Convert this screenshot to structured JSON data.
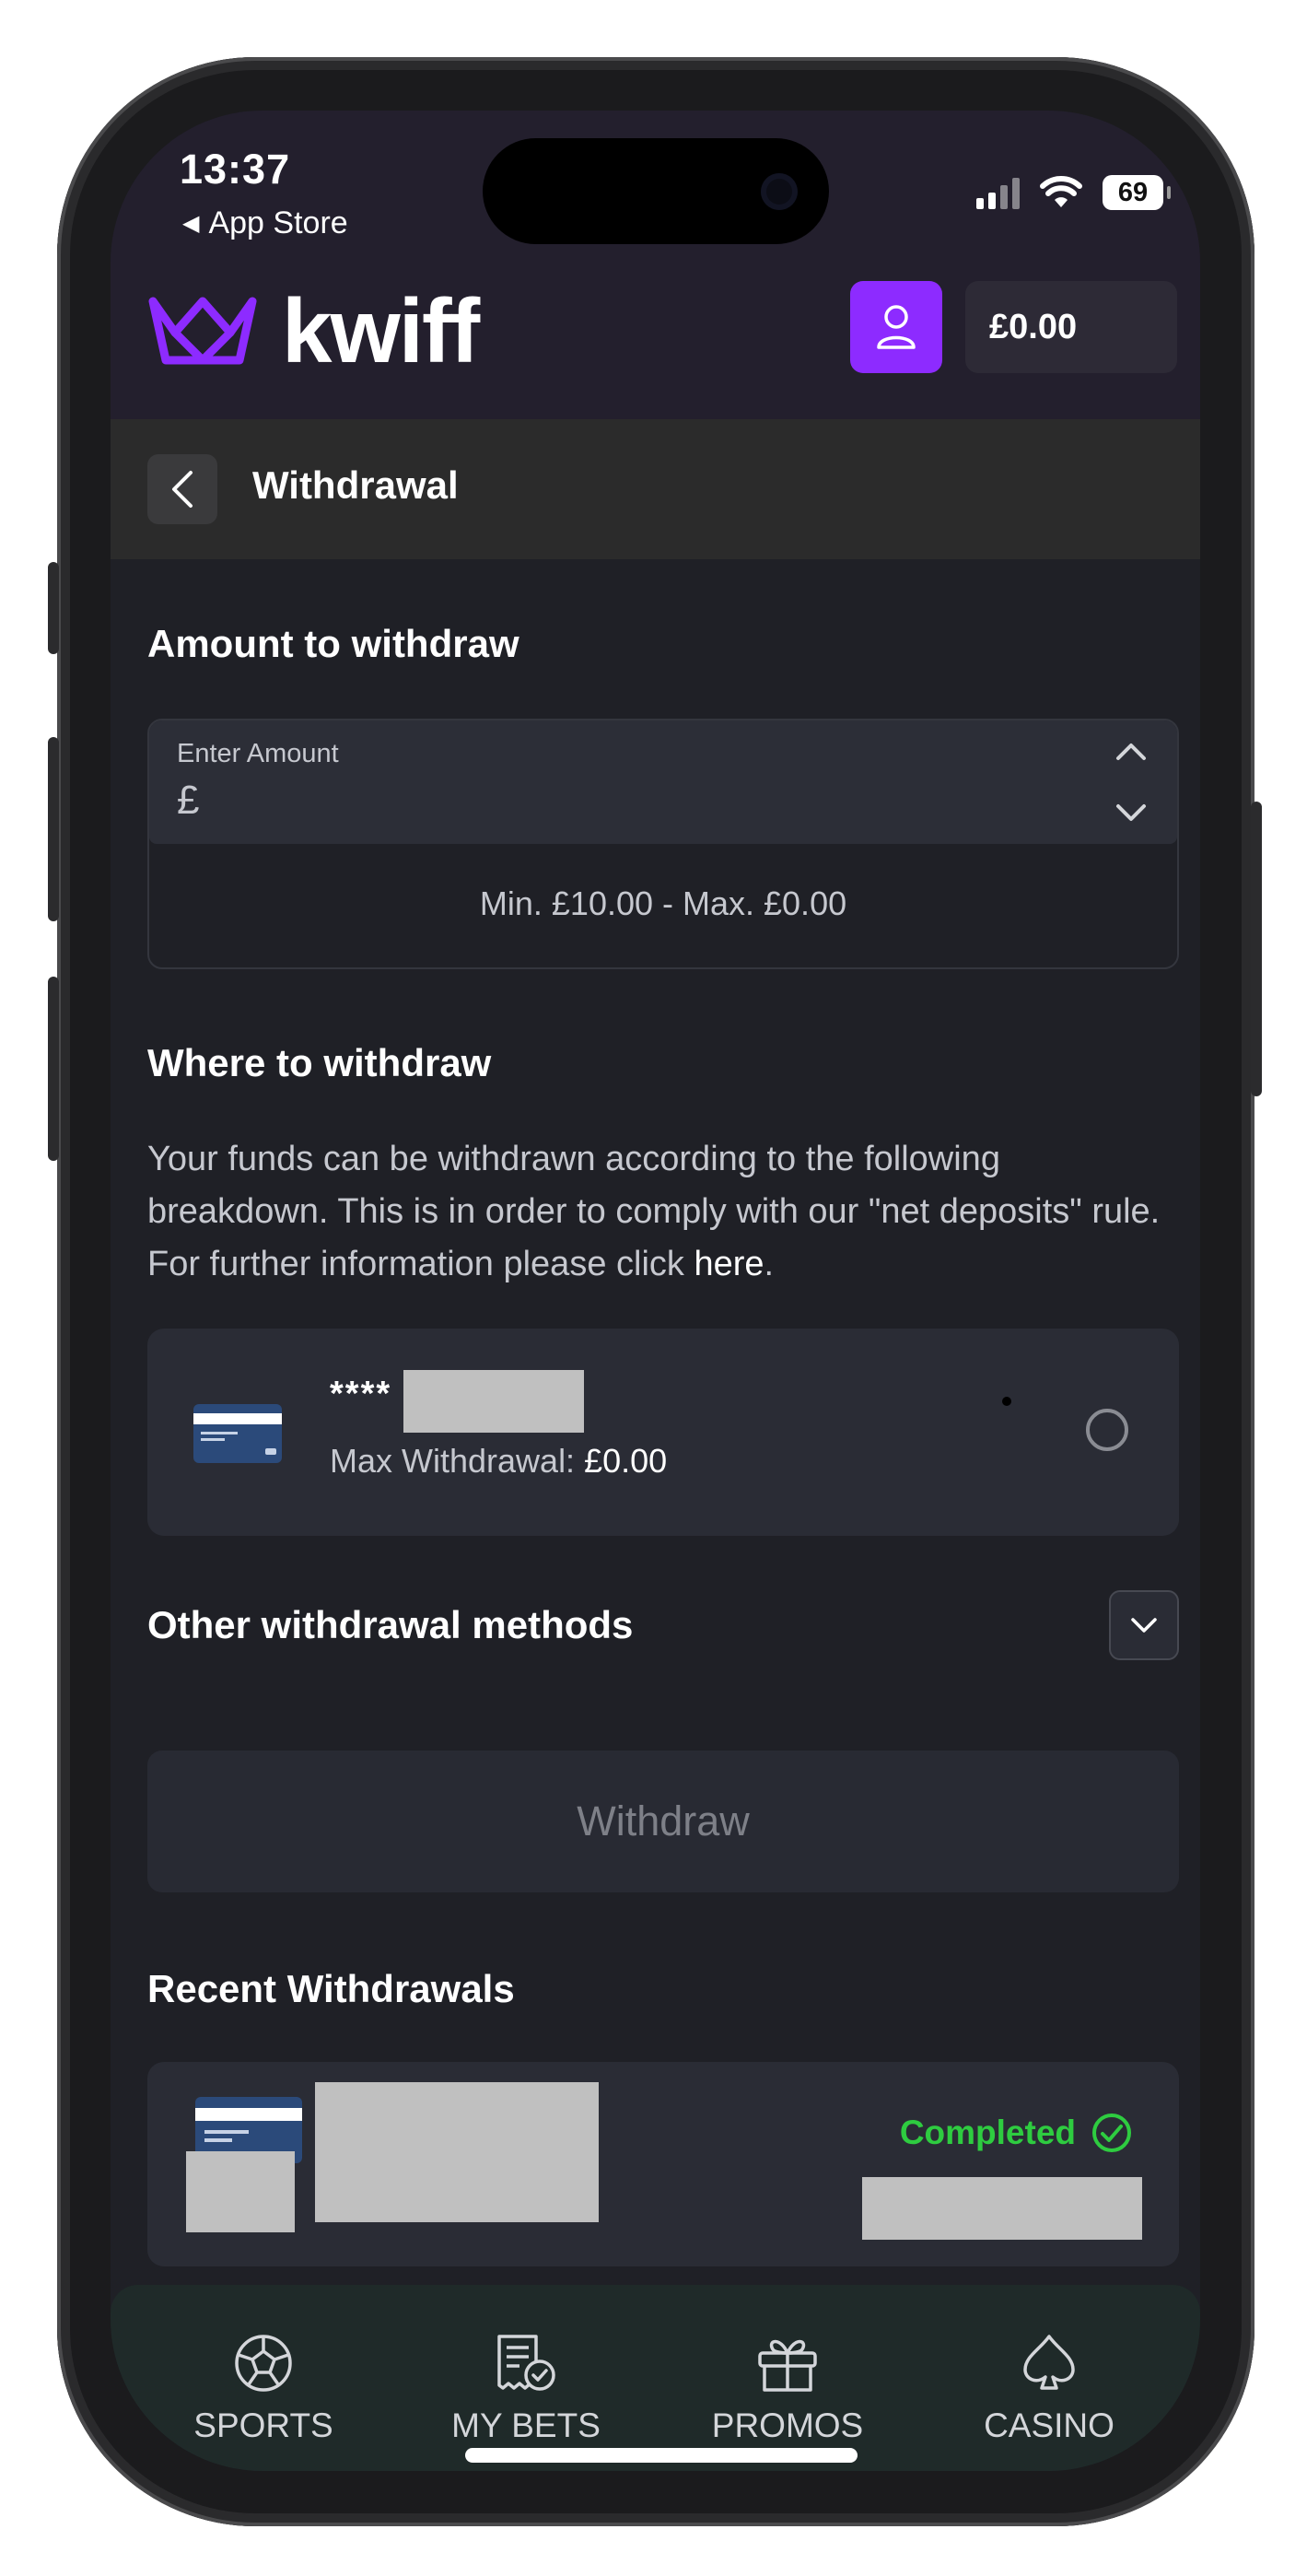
{
  "status_bar": {
    "time": "13:37",
    "back_app": "App Store",
    "battery": "69"
  },
  "header": {
    "logo_text": "kwiff",
    "balance": "£0.00"
  },
  "subheader": {
    "title": "Withdrawal"
  },
  "amount_section": {
    "title": "Amount to withdraw",
    "input_label": "Enter Amount",
    "currency_symbol": "£",
    "limits": "Min. £10.00 - Max. £0.00"
  },
  "where_section": {
    "title": "Where to withdraw",
    "description": "Your funds can be withdrawn according to the following breakdown. This is in order to comply with our \"net deposits\" rule. For further information please click",
    "link_text": "here",
    "link_suffix": ".",
    "card": {
      "masked_number": "****",
      "max_label": "Max Withdrawal:",
      "max_value": "£0.00"
    }
  },
  "other_methods": {
    "title": "Other withdrawal methods"
  },
  "withdraw_button": "Withdraw",
  "recent": {
    "title": "Recent Withdrawals",
    "status": "Completed"
  },
  "tabs": [
    {
      "label": "SPORTS",
      "icon": "soccer-ball-icon"
    },
    {
      "label": "MY BETS",
      "icon": "bet-slip-icon"
    },
    {
      "label": "PROMOS",
      "icon": "gift-icon"
    },
    {
      "label": "CASINO",
      "icon": "spade-icon"
    }
  ],
  "colors": {
    "accent": "#8d2bff",
    "success": "#2ecc40",
    "background": "#1f2026",
    "header": "#231f2d"
  }
}
